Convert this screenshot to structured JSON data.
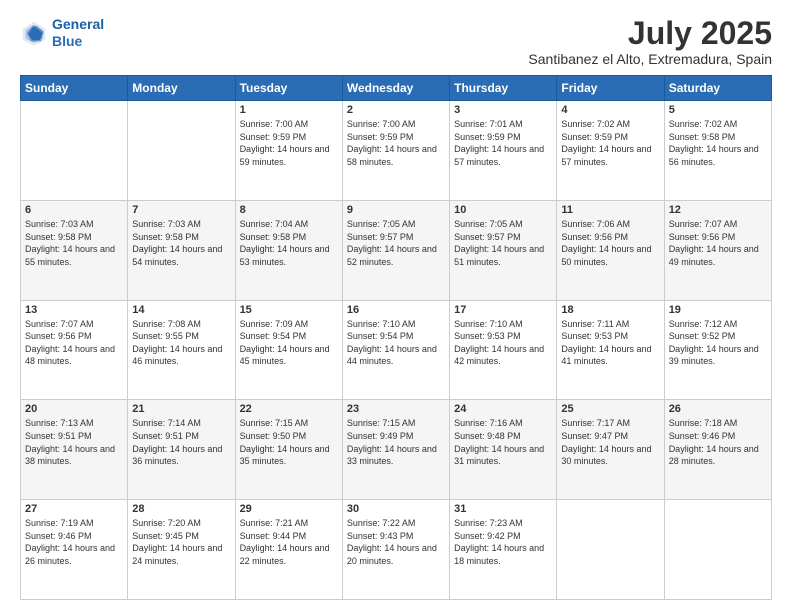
{
  "header": {
    "logo_line1": "General",
    "logo_line2": "Blue",
    "title": "July 2025",
    "subtitle": "Santibanez el Alto, Extremadura, Spain"
  },
  "weekdays": [
    "Sunday",
    "Monday",
    "Tuesday",
    "Wednesday",
    "Thursday",
    "Friday",
    "Saturday"
  ],
  "weeks": [
    [
      {
        "day": "",
        "info": ""
      },
      {
        "day": "",
        "info": ""
      },
      {
        "day": "1",
        "info": "Sunrise: 7:00 AM\nSunset: 9:59 PM\nDaylight: 14 hours and 59 minutes."
      },
      {
        "day": "2",
        "info": "Sunrise: 7:00 AM\nSunset: 9:59 PM\nDaylight: 14 hours and 58 minutes."
      },
      {
        "day": "3",
        "info": "Sunrise: 7:01 AM\nSunset: 9:59 PM\nDaylight: 14 hours and 57 minutes."
      },
      {
        "day": "4",
        "info": "Sunrise: 7:02 AM\nSunset: 9:59 PM\nDaylight: 14 hours and 57 minutes."
      },
      {
        "day": "5",
        "info": "Sunrise: 7:02 AM\nSunset: 9:58 PM\nDaylight: 14 hours and 56 minutes."
      }
    ],
    [
      {
        "day": "6",
        "info": "Sunrise: 7:03 AM\nSunset: 9:58 PM\nDaylight: 14 hours and 55 minutes."
      },
      {
        "day": "7",
        "info": "Sunrise: 7:03 AM\nSunset: 9:58 PM\nDaylight: 14 hours and 54 minutes."
      },
      {
        "day": "8",
        "info": "Sunrise: 7:04 AM\nSunset: 9:58 PM\nDaylight: 14 hours and 53 minutes."
      },
      {
        "day": "9",
        "info": "Sunrise: 7:05 AM\nSunset: 9:57 PM\nDaylight: 14 hours and 52 minutes."
      },
      {
        "day": "10",
        "info": "Sunrise: 7:05 AM\nSunset: 9:57 PM\nDaylight: 14 hours and 51 minutes."
      },
      {
        "day": "11",
        "info": "Sunrise: 7:06 AM\nSunset: 9:56 PM\nDaylight: 14 hours and 50 minutes."
      },
      {
        "day": "12",
        "info": "Sunrise: 7:07 AM\nSunset: 9:56 PM\nDaylight: 14 hours and 49 minutes."
      }
    ],
    [
      {
        "day": "13",
        "info": "Sunrise: 7:07 AM\nSunset: 9:56 PM\nDaylight: 14 hours and 48 minutes."
      },
      {
        "day": "14",
        "info": "Sunrise: 7:08 AM\nSunset: 9:55 PM\nDaylight: 14 hours and 46 minutes."
      },
      {
        "day": "15",
        "info": "Sunrise: 7:09 AM\nSunset: 9:54 PM\nDaylight: 14 hours and 45 minutes."
      },
      {
        "day": "16",
        "info": "Sunrise: 7:10 AM\nSunset: 9:54 PM\nDaylight: 14 hours and 44 minutes."
      },
      {
        "day": "17",
        "info": "Sunrise: 7:10 AM\nSunset: 9:53 PM\nDaylight: 14 hours and 42 minutes."
      },
      {
        "day": "18",
        "info": "Sunrise: 7:11 AM\nSunset: 9:53 PM\nDaylight: 14 hours and 41 minutes."
      },
      {
        "day": "19",
        "info": "Sunrise: 7:12 AM\nSunset: 9:52 PM\nDaylight: 14 hours and 39 minutes."
      }
    ],
    [
      {
        "day": "20",
        "info": "Sunrise: 7:13 AM\nSunset: 9:51 PM\nDaylight: 14 hours and 38 minutes."
      },
      {
        "day": "21",
        "info": "Sunrise: 7:14 AM\nSunset: 9:51 PM\nDaylight: 14 hours and 36 minutes."
      },
      {
        "day": "22",
        "info": "Sunrise: 7:15 AM\nSunset: 9:50 PM\nDaylight: 14 hours and 35 minutes."
      },
      {
        "day": "23",
        "info": "Sunrise: 7:15 AM\nSunset: 9:49 PM\nDaylight: 14 hours and 33 minutes."
      },
      {
        "day": "24",
        "info": "Sunrise: 7:16 AM\nSunset: 9:48 PM\nDaylight: 14 hours and 31 minutes."
      },
      {
        "day": "25",
        "info": "Sunrise: 7:17 AM\nSunset: 9:47 PM\nDaylight: 14 hours and 30 minutes."
      },
      {
        "day": "26",
        "info": "Sunrise: 7:18 AM\nSunset: 9:46 PM\nDaylight: 14 hours and 28 minutes."
      }
    ],
    [
      {
        "day": "27",
        "info": "Sunrise: 7:19 AM\nSunset: 9:46 PM\nDaylight: 14 hours and 26 minutes."
      },
      {
        "day": "28",
        "info": "Sunrise: 7:20 AM\nSunset: 9:45 PM\nDaylight: 14 hours and 24 minutes."
      },
      {
        "day": "29",
        "info": "Sunrise: 7:21 AM\nSunset: 9:44 PM\nDaylight: 14 hours and 22 minutes."
      },
      {
        "day": "30",
        "info": "Sunrise: 7:22 AM\nSunset: 9:43 PM\nDaylight: 14 hours and 20 minutes."
      },
      {
        "day": "31",
        "info": "Sunrise: 7:23 AM\nSunset: 9:42 PM\nDaylight: 14 hours and 18 minutes."
      },
      {
        "day": "",
        "info": ""
      },
      {
        "day": "",
        "info": ""
      }
    ]
  ]
}
